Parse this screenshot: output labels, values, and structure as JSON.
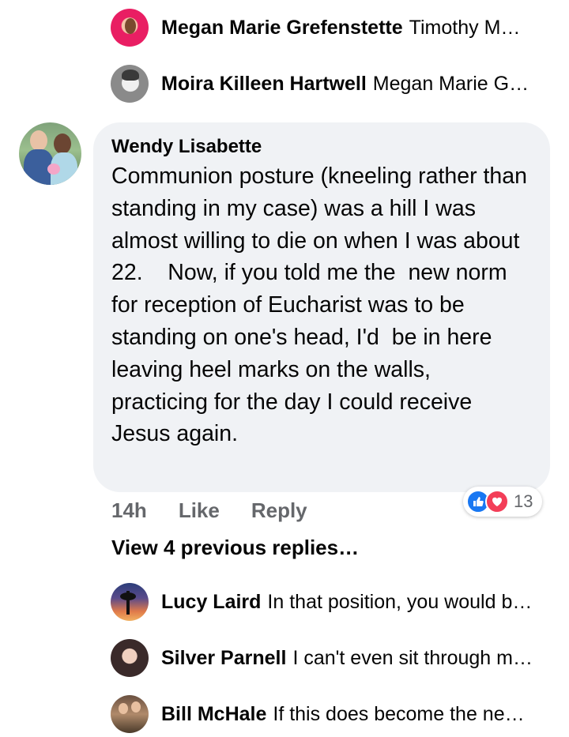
{
  "top_replies": [
    {
      "name": "Megan Marie Grefenstette",
      "snippet": "Timothy M…",
      "avatar_icon": "avatar-photo",
      "avatar_colors": [
        "#e91e63",
        "#f8bbd0"
      ]
    },
    {
      "name": "Moira Killeen Hartwell",
      "snippet": "Megan Marie G…",
      "avatar_icon": "avatar-photo",
      "avatar_colors": [
        "#9e9e9e",
        "#e0e0e0"
      ]
    }
  ],
  "comment": {
    "author": "Wendy Lisabette",
    "text": "Communion posture (kneeling rather than standing in my case) was a hill I was almost willing to die on when I was about 22.    Now, if you told me the  new norm for reception of Eucharist was to be standing on one's head, I'd  be in here leaving heel marks on the walls, practicing for the day I could receive Jesus again.",
    "time": "14h",
    "like_label": "Like",
    "reply_label": "Reply",
    "reaction_count": "13",
    "reaction_icons": [
      "like-icon",
      "love-icon"
    ],
    "colors": {
      "like": "#1877f2",
      "love": "#f33e58",
      "bubble": "#f0f2f5"
    }
  },
  "view_previous": "View 4 previous replies…",
  "bottom_replies": [
    {
      "name": "Lucy Laird",
      "snippet": "In that position, you would b…"
    },
    {
      "name": "Silver Parnell",
      "snippet": "I can't even sit through m…"
    },
    {
      "name": "Bill McHale",
      "snippet": "If this does become the ne…"
    }
  ]
}
